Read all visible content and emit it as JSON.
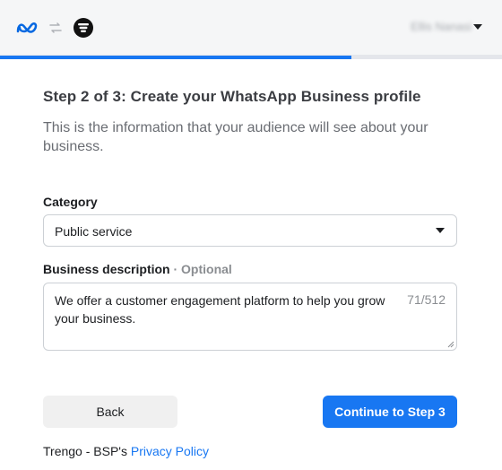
{
  "header": {
    "account_name": "Ellis Nanasi"
  },
  "progress": {
    "step": 2,
    "total_steps": 3,
    "fraction": 0.7
  },
  "main": {
    "title": "Step 2 of 3: Create your WhatsApp Business profile",
    "subtitle": "This is the information that your audience will see about your business."
  },
  "category": {
    "label": "Category",
    "value": "Public service"
  },
  "description": {
    "label": "Business description",
    "optional": " · Optional",
    "value": "We offer a customer engagement platform to help you grow your business.",
    "counter": "71/512"
  },
  "buttons": {
    "back": "Back",
    "continue": "Continue to Step 3"
  },
  "footer": {
    "prefix": "Trengo - BSP's ",
    "link": "Privacy Policy"
  },
  "colors": {
    "accent": "#1877f2",
    "header_bg": "#f5f6f7"
  },
  "icons": {
    "meta": "meta-logo-icon",
    "swap": "swap-icon",
    "partner": "trengo-logo-icon",
    "caret": "caret-down-icon"
  }
}
